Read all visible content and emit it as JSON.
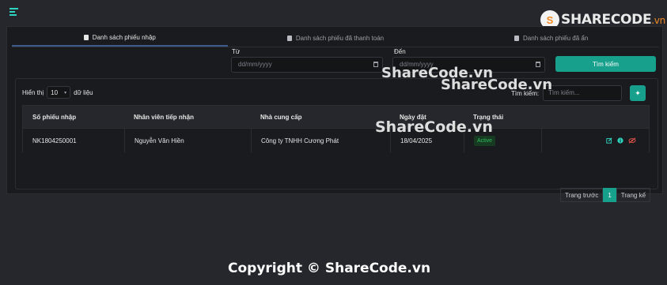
{
  "logo": {
    "mark": "S",
    "name": "SHARECODE",
    "domain": ".vn"
  },
  "tabs": [
    {
      "label": "Danh sách phiếu nhập"
    },
    {
      "label": "Danh sách phiếu đã thanh toán"
    },
    {
      "label": "Danh sách phiếu đã ẩn"
    }
  ],
  "filters": {
    "from_label": "Từ",
    "to_label": "Đến",
    "date_placeholder": "dd/mm/yyyy",
    "search_button": "Tìm kiếm"
  },
  "table_controls": {
    "show_prefix": "Hiển thị",
    "page_length": "10",
    "show_suffix": "dữ liệu",
    "search_label": "Tìm kiếm:",
    "search_placeholder": "Tìm kiếm..."
  },
  "table": {
    "headers": [
      "Số phiếu nhập",
      "Nhân viên tiếp nhận",
      "Nhà cung cấp",
      "Ngày đặt",
      "Trạng thái"
    ],
    "rows": [
      {
        "id": "NK1804250001",
        "staff": "Nguyễn Văn Hiền",
        "supplier": "Công ty TNHH Cương Phát",
        "date": "18/04/2025",
        "status": "Active"
      }
    ]
  },
  "pagination": {
    "prev": "Trang trước",
    "current": "1",
    "next": "Trang kế"
  },
  "watermarks": [
    "ShareCode.vn",
    "ShareCode.vn",
    "ShareCode.vn"
  ],
  "copyright": "Copyright © ShareCode.vn",
  "colors": {
    "accent": "#17a08c",
    "status_active": "#2fbf5a",
    "brand_orange": "#f08a24",
    "background": "#1a1b1e"
  }
}
